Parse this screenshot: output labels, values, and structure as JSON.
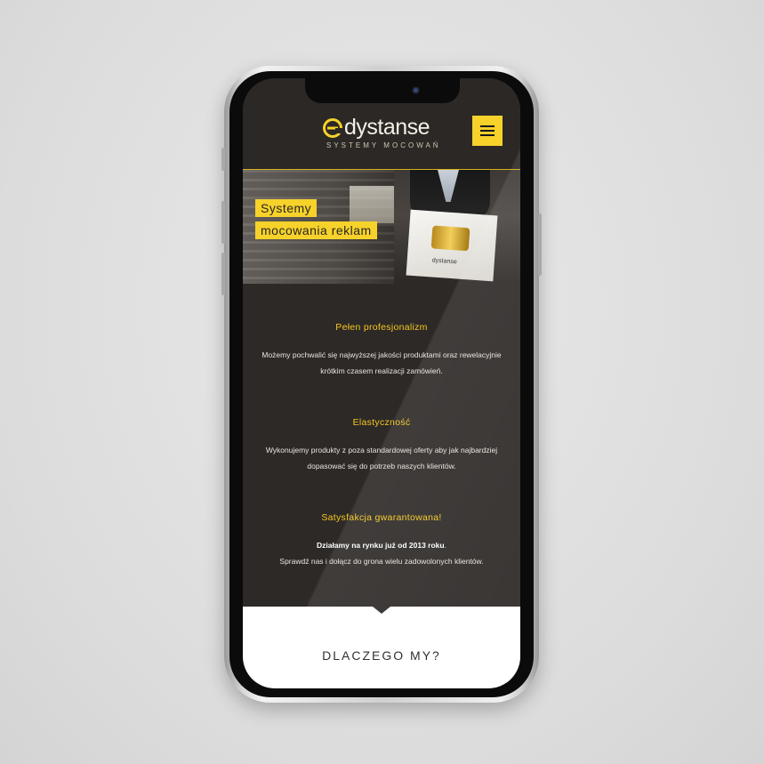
{
  "brand": {
    "name": "dystanse",
    "tagline": "SYSTEMY MOCOWAŃ",
    "accent_color": "#f6d22a",
    "heading_color": "#f6c81f"
  },
  "header": {
    "menu_icon": "hamburger-menu-icon"
  },
  "hero": {
    "label_line1": "Systemy",
    "label_line2": "mocowania reklam",
    "card_brand": "dystanse"
  },
  "features": [
    {
      "title": "Pełen profesjonalizm",
      "text": "Możemy pochwalić się najwyższej jakości produktami oraz rewelacyjnie krótkim czasem realizacji zamówień."
    },
    {
      "title": "Elastyczność",
      "text": "Wykonujemy produkty z poza standardowej oferty aby jak najbardziej dopasować się do potrzeb naszych klientów."
    },
    {
      "title": "Satysfakcja gwarantowana!",
      "text_bold": "Działamy na rynku już od 2013 roku",
      "text_bold_suffix": ".",
      "text": "Sprawdź nas i dołącz do grona wielu zadowolonych klientów."
    }
  ],
  "section": {
    "why_title": "DLACZEGO MY?"
  }
}
